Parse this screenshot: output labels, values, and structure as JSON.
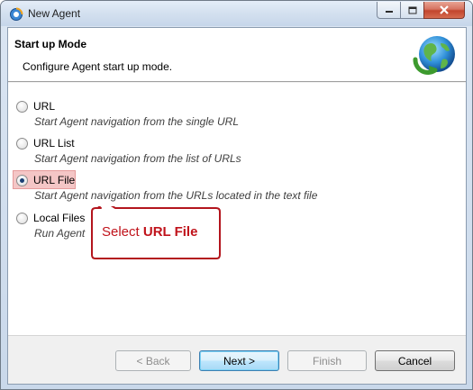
{
  "window": {
    "title": "New Agent",
    "controls": {
      "minimize_icon": "minimize-icon",
      "maximize_icon": "maximize-icon",
      "close_icon": "close-icon"
    }
  },
  "header": {
    "title": "Start up Mode",
    "description": "Configure Agent start up mode.",
    "icon": "globe-refresh-icon"
  },
  "options": [
    {
      "label": "URL",
      "description": "Start Agent navigation from the single URL",
      "checked": false
    },
    {
      "label": "URL List",
      "description": "Start Agent navigation from the list of URLs",
      "checked": false
    },
    {
      "label": "URL File",
      "description": "Start Agent navigation from the URLs located in the text file",
      "checked": true
    },
    {
      "label": "Local Files",
      "description": "Run Agent",
      "checked": false
    }
  ],
  "callout": {
    "prefix": "Select",
    "emphasis": "URL File"
  },
  "buttons": {
    "back": "< Back",
    "next": "Next >",
    "finish": "Finish",
    "cancel": "Cancel"
  },
  "colors": {
    "callout_text": "#c0131b",
    "callout_border": "#b3151d",
    "highlight": "#f4c6c6"
  }
}
